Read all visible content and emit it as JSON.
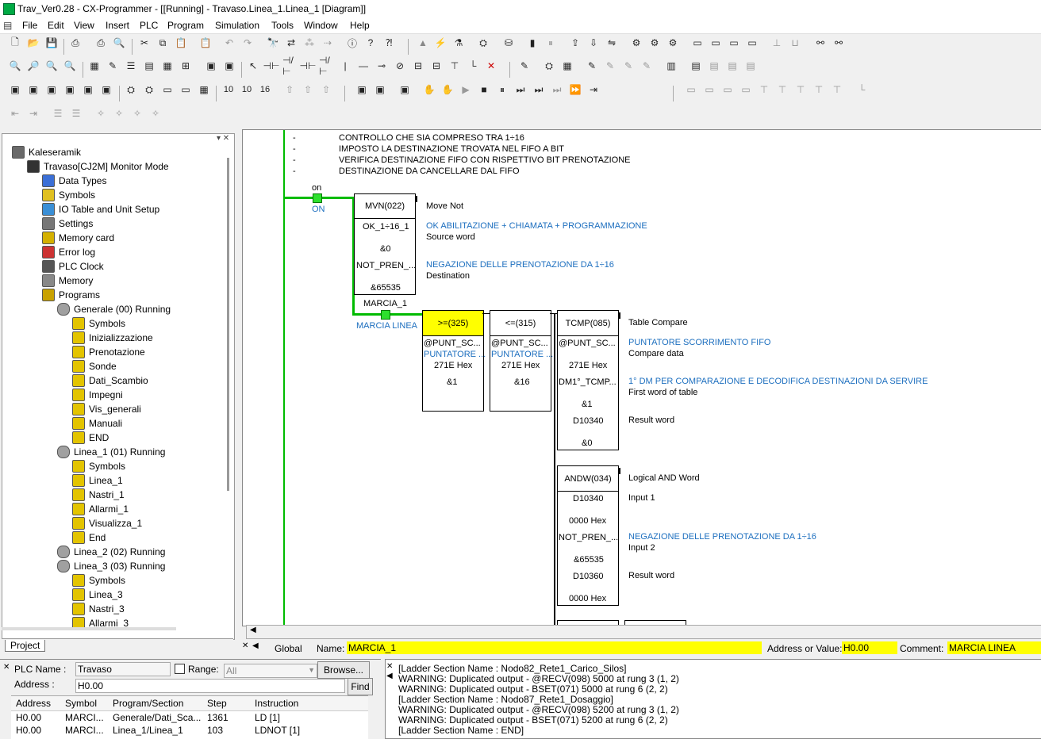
{
  "window": {
    "title": "Trav_Ver0.28 - CX-Programmer - [[Running] - Travaso.Linea_1.Linea_1 [Diagram]]"
  },
  "menu": [
    "File",
    "Edit",
    "View",
    "Insert",
    "PLC",
    "Program",
    "Simulation",
    "Tools",
    "Window",
    "Help"
  ],
  "tree": {
    "items": [
      {
        "label": "Kaleseramik",
        "icon": "project-icon",
        "level": 0
      },
      {
        "label": "Travaso[CJ2M] Monitor Mode",
        "icon": "plc-icon",
        "level": 1
      },
      {
        "label": "Data Types",
        "icon": "data-types-icon",
        "level": 2
      },
      {
        "label": "Symbols",
        "icon": "symbols-icon",
        "level": 2
      },
      {
        "label": "IO Table and Unit Setup",
        "icon": "io-table-icon",
        "level": 2
      },
      {
        "label": "Settings",
        "icon": "settings-icon",
        "level": 2
      },
      {
        "label": "Memory card",
        "icon": "memory-card-icon",
        "level": 2
      },
      {
        "label": "Error log",
        "icon": "error-log-icon",
        "level": 2
      },
      {
        "label": "PLC Clock",
        "icon": "clock-icon",
        "level": 2
      },
      {
        "label": "Memory",
        "icon": "memory-icon",
        "level": 2
      },
      {
        "label": "Programs",
        "icon": "programs-icon",
        "level": 2
      },
      {
        "label": "Generale (00) Running",
        "icon": "task-icon",
        "level": 3
      },
      {
        "label": "Symbols",
        "icon": "section-icon",
        "level": 4
      },
      {
        "label": "Inizializzazione",
        "icon": "section-icon",
        "level": 4
      },
      {
        "label": "Prenotazione",
        "icon": "section-icon",
        "level": 4
      },
      {
        "label": "Sonde",
        "icon": "section-icon",
        "level": 4
      },
      {
        "label": "Dati_Scambio",
        "icon": "section-icon",
        "level": 4
      },
      {
        "label": "Impegni",
        "icon": "section-icon",
        "level": 4
      },
      {
        "label": "Vis_generali",
        "icon": "section-icon",
        "level": 4
      },
      {
        "label": "Manuali",
        "icon": "section-icon",
        "level": 4
      },
      {
        "label": "END",
        "icon": "section-icon",
        "level": 4
      },
      {
        "label": "Linea_1 (01) Running",
        "icon": "task-icon",
        "level": 3
      },
      {
        "label": "Symbols",
        "icon": "section-icon",
        "level": 4
      },
      {
        "label": "Linea_1",
        "icon": "section-icon",
        "level": 4
      },
      {
        "label": "Nastri_1",
        "icon": "section-icon",
        "level": 4
      },
      {
        "label": "Allarmi_1",
        "icon": "section-icon",
        "level": 4
      },
      {
        "label": "Visualizza_1",
        "icon": "section-icon",
        "level": 4
      },
      {
        "label": "End",
        "icon": "section-icon",
        "level": 4
      },
      {
        "label": "Linea_2 (02) Running",
        "icon": "task-icon",
        "level": 3
      },
      {
        "label": "Linea_3 (03) Running",
        "icon": "task-icon",
        "level": 3
      },
      {
        "label": "Symbols",
        "icon": "section-icon",
        "level": 4
      },
      {
        "label": "Linea_3",
        "icon": "section-icon",
        "level": 4
      },
      {
        "label": "Nastri_3",
        "icon": "section-icon",
        "level": 4
      },
      {
        "label": "Allarmi_3",
        "icon": "section-icon",
        "level": 4
      }
    ],
    "tab": "Project"
  },
  "diagram": {
    "comments": [
      "CONTROLLO CHE SIA COMPRESO TRA 1÷16",
      "IMPOSTO LA DESTINAZIONE TROVATA NEL FIFO A BIT",
      "VERIFICA DESTINAZIONE FIFO CON RISPETTIVO BIT PRENOTAZIONE",
      "DESTINAZIONE DA CANCELLARE DAL FIFO"
    ],
    "dash": "-",
    "contact_on": {
      "name": "on",
      "comment": "ON"
    },
    "contact_marcia": {
      "name": "MARCIA_1",
      "comment": "MARCIA LINEA"
    },
    "mvn": {
      "title": "MVN(022)",
      "op1": "OK_1÷16_1",
      "op2": "&0",
      "op3": "NOT_PREN_...",
      "op4": "&65535",
      "desc": "Move Not",
      "c1": "OK ABILITAZIONE + CHIAMATA + PROGRAMMAZIONE",
      "l1": "Source word",
      "c2": "NEGAZIONE DELLE PRENOTAZIONE DA 1÷16",
      "l2": "Destination"
    },
    "ge": {
      "title": ">=(325)",
      "op1": "@PUNT_SC...",
      "op2": "PUNTATORE ...",
      "op3": "271E Hex",
      "op4": "&1"
    },
    "le": {
      "title": "<=(315)",
      "op1": "@PUNT_SC...",
      "op2": "PUNTATORE ...",
      "op3": "271E Hex",
      "op4": "&16"
    },
    "tcmp": {
      "title": "TCMP(085)",
      "op1": "@PUNT_SC...",
      "op2": "271E Hex",
      "op3": "DM1°_TCMP...",
      "op4": "&1",
      "op5": "D10340",
      "op6": "&0",
      "desc": "Table Compare",
      "c1": "PUNTATORE SCORRIMENTO FIFO",
      "l1": "Compare data",
      "c2": "1° DM PER COMPARAZIONE E DECODIFICA DESTINAZIONI DA SERVIRE",
      "l2": "First word of table",
      "l3": "Result word"
    },
    "andw": {
      "title": "ANDW(034)",
      "op1": "D10340",
      "op2": "0000 Hex",
      "op3": "NOT_PREN_...",
      "op4": "&65535",
      "op5": "D10360",
      "op6": "0000 Hex",
      "desc": "Logical AND Word",
      "l1": "Input 1",
      "c2": "NEGAZIONE DELLE PRENOTAZIONE DA 1÷16",
      "l2": "Input 2",
      "l3": "Result word"
    }
  },
  "status": {
    "scope": "Global",
    "name_label": "Name:",
    "name_value": "MARCIA_1",
    "addr_label": "Address or Value:",
    "addr_value": "H0.00",
    "comment_label": "Comment:",
    "comment_value": "MARCIA LINEA"
  },
  "xref": {
    "plc_label": "PLC Name :",
    "plc_value": "Travaso",
    "range_label": "Range:",
    "range_value": "All",
    "browse": "Browse...",
    "address_label": "Address :",
    "address_value": "H0.00",
    "find": "Find",
    "columns": [
      "Address",
      "Symbol",
      "Program/Section",
      "Step",
      "Instruction"
    ],
    "rows": [
      [
        "H0.00",
        "MARCI...",
        "Generale/Dati_Sca...",
        "1361",
        "LD [1]"
      ],
      [
        "H0.00",
        "MARCI...",
        "Linea_1/Linea_1",
        "103",
        "LDNOT [1]"
      ]
    ]
  },
  "output": [
    "[Ladder Section Name : Nodo82_Rete1_Carico_Silos]",
    "WARNING: Duplicated output -  @RECV(098) 5000 at rung 3 (1, 2)",
    "WARNING: Duplicated output -  BSET(071) 5000 at rung 6 (2, 2)",
    "[Ladder Section Name : Nodo87_Rete1_Dosaggio]",
    "WARNING: Duplicated output -  @RECV(098) 5200 at rung 3 (1, 2)",
    "WARNING: Duplicated output -  BSET(071) 5200 at rung 6 (2, 2)",
    "[Ladder Section Name : END]"
  ],
  "colors": {
    "highlight": "#ffff00",
    "power": "#00c800",
    "comment_blue": "#1d6fbf"
  }
}
